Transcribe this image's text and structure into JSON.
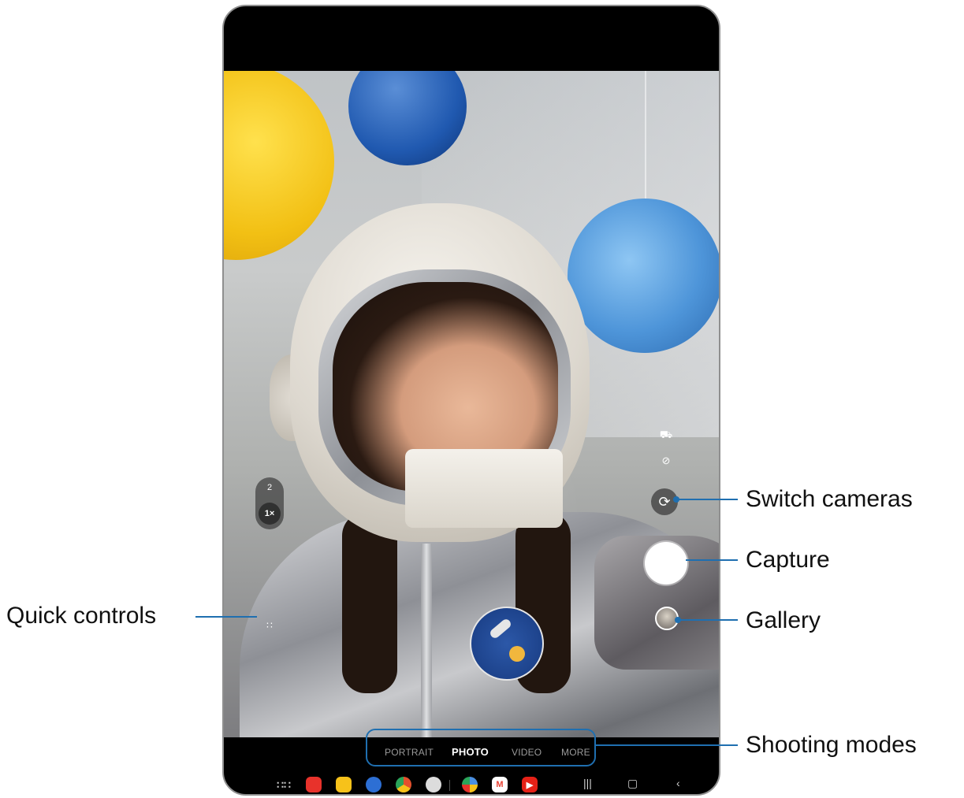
{
  "callouts": {
    "switch_cameras": "Switch cameras",
    "capture": "Capture",
    "gallery": "Gallery",
    "quick_controls": "Quick controls",
    "shooting_modes": "Shooting modes"
  },
  "zoom": {
    "option_2": "2",
    "option_1x": "1×"
  },
  "modes": [
    "PORTRAIT",
    "PHOTO",
    "VIDEO",
    "MORE"
  ],
  "active_mode": "PHOTO",
  "taskbar_apps": [
    {
      "icon": "apps-grid-icon"
    },
    {
      "icon": "notes-app-icon",
      "color": "#e8322b"
    },
    {
      "icon": "folder-app-icon",
      "color": "#f7c21a"
    },
    {
      "icon": "messages-app-icon",
      "color": "#2d6fd4"
    },
    {
      "icon": "chrome-app-icon",
      "color": "#e4502d"
    },
    {
      "icon": "camera-app-icon",
      "color": "#dcdcdc"
    },
    {
      "icon": "gallery-app-icon",
      "color": "#4a8fe0"
    },
    {
      "icon": "gmail-app-icon",
      "color": "#ea4335"
    },
    {
      "icon": "youtube-app-icon",
      "color": "#e62117"
    }
  ],
  "nav_buttons": [
    "recents-icon",
    "home-icon",
    "back-icon"
  ],
  "colors": {
    "callout_blue": "#1f6fb0",
    "active_mode": "#ffffff",
    "inactive_mode": "#9a9a9a"
  }
}
